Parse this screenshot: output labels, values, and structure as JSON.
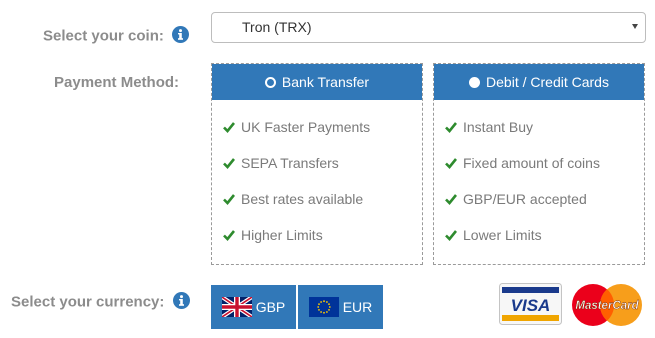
{
  "coin": {
    "label": "Select your coin:",
    "selected": "Tron (TRX)"
  },
  "payment": {
    "label": "Payment Method:",
    "options": [
      {
        "title": "Bank Transfer",
        "selected": true,
        "features": [
          "UK Faster Payments",
          "SEPA Transfers",
          "Best rates available",
          "Higher Limits"
        ]
      },
      {
        "title": "Debit / Credit Cards",
        "selected": false,
        "features": [
          "Instant Buy",
          "Fixed amount of coins",
          "GBP/EUR accepted",
          "Lower Limits"
        ]
      }
    ]
  },
  "currency": {
    "label": "Select your currency:",
    "options": [
      {
        "code": "GBP",
        "flag": "uk-flag-icon"
      },
      {
        "code": "EUR",
        "flag": "eu-flag-icon"
      }
    ]
  },
  "cards": {
    "visa": "VISA",
    "mastercard": "MasterCard"
  },
  "colors": {
    "accent": "#3178b8",
    "check": "#2e8b2e",
    "label": "#8c8c8c"
  }
}
